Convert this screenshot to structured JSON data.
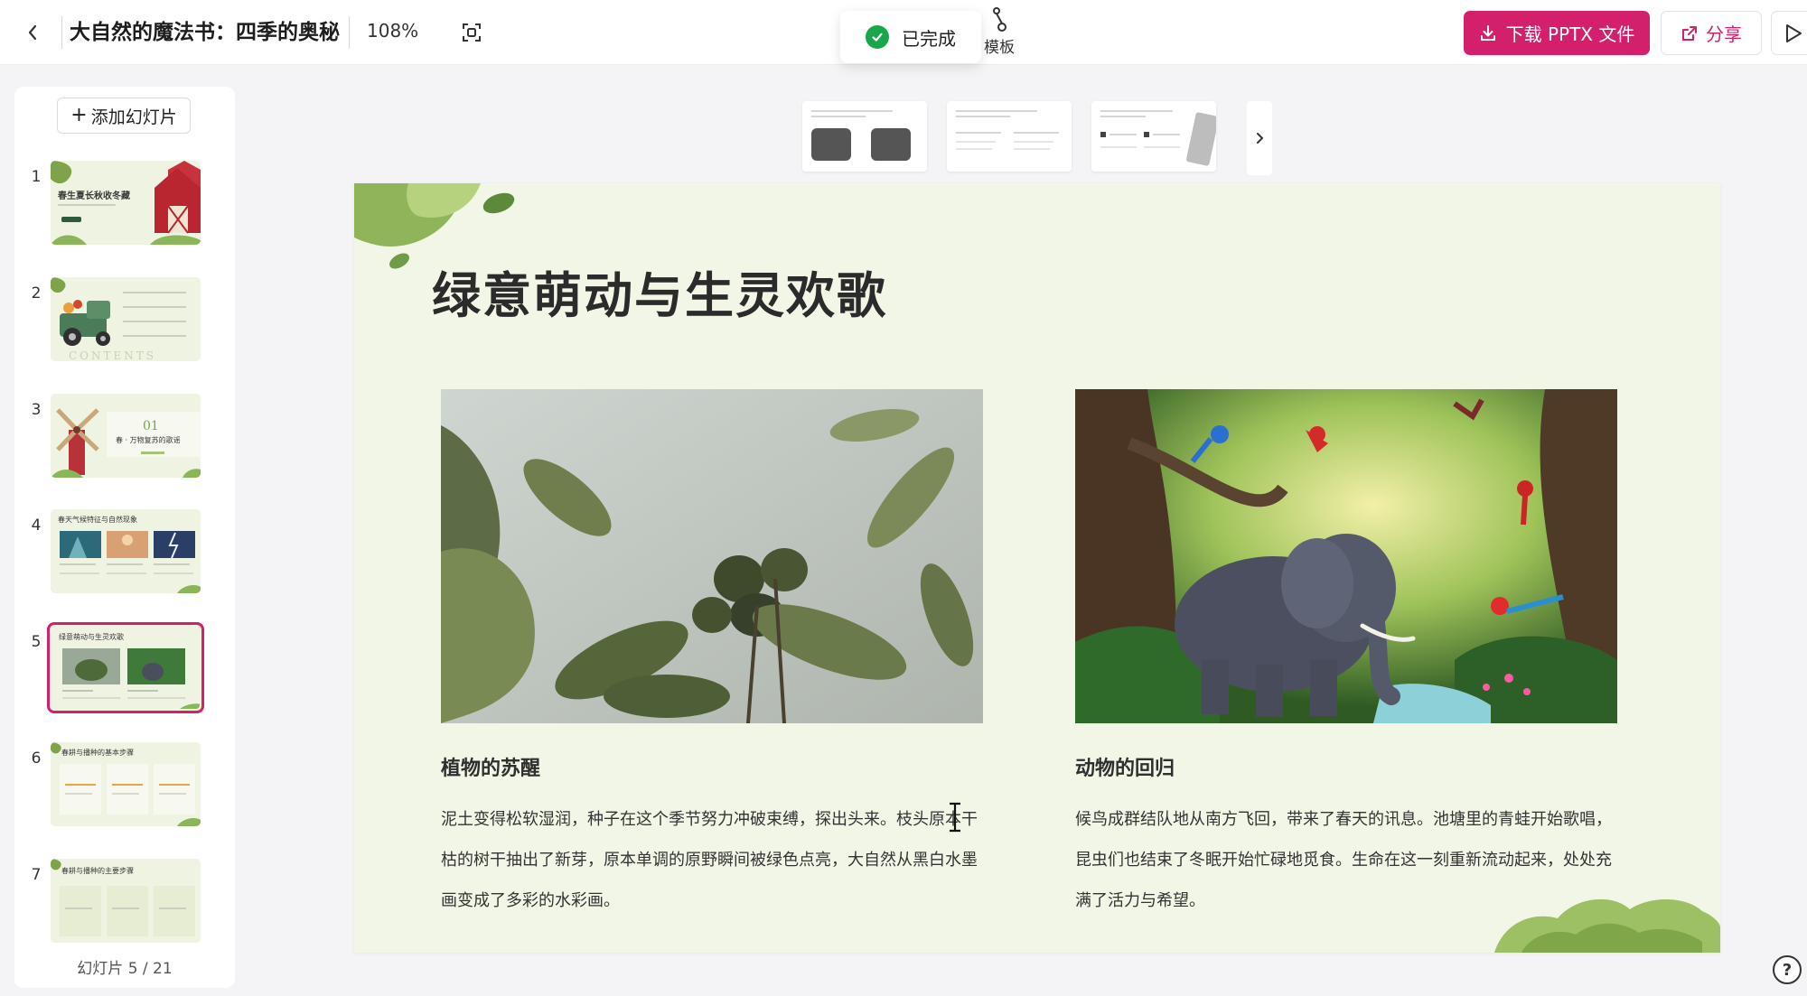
{
  "header": {
    "doc_title": "大自然的魔法书：四季的奥秘",
    "zoom": "108%",
    "toast_text": "已完成",
    "template_label": "模板",
    "download_label": "下载 PPTX 文件",
    "share_label": "分享"
  },
  "sidebar": {
    "add_slide_label": "添加幻灯片",
    "counter": "幻灯片 5 / 21",
    "thumbnails": [
      {
        "num": "1",
        "title": "春生夏长秋收冬藏"
      },
      {
        "num": "2",
        "title": "CONTENTS"
      },
      {
        "num": "3",
        "title": "01",
        "subtitle": "春 · 万物复苏的歌谣"
      },
      {
        "num": "4",
        "title": "春天气候特征与自然现象"
      },
      {
        "num": "5",
        "title": "绿意萌动与生灵欢歌"
      },
      {
        "num": "6",
        "title": "春耕与播种的基本步骤"
      },
      {
        "num": "7",
        "title": "春耕与播种的主要步骤"
      }
    ]
  },
  "slide": {
    "title": "绿意萌动与生灵欢歌",
    "left": {
      "heading": "植物的苏醒",
      "body": "泥土变得松软湿润，种子在这个季节努力冲破束缚，探出头来。枝头原本干枯的树干抽出了新芽，原本单调的原野瞬间被绿色点亮，大自然从黑白水墨画变成了多彩的水彩画。"
    },
    "right": {
      "heading": "动物的回归",
      "body": "候鸟成群结队地从南方飞回，带来了春天的讯息。池塘里的青蛙开始歌唱，昆虫们也结束了冬眠开始忙碌地觅食。生命在这一刻重新流动起来，处处充满了活力与希望。"
    }
  },
  "colors": {
    "accent": "#d41f6c",
    "slide_bg": "#f2f6e7",
    "success": "#19a74b"
  }
}
